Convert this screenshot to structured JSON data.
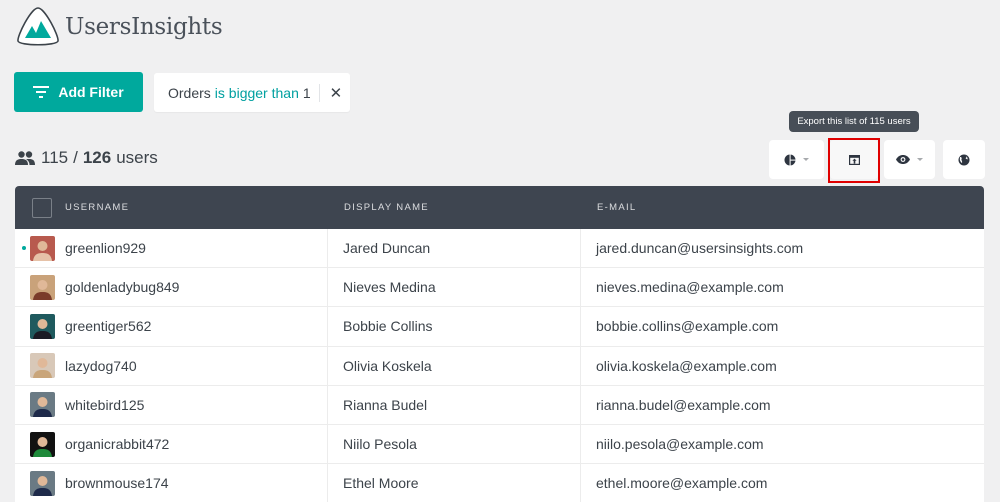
{
  "app": {
    "name": "UsersInsights",
    "accent_color": "#00a99d"
  },
  "toolbar": {
    "add_filter_label": "Add Filter",
    "filter": {
      "field": "Orders",
      "operator": "is bigger than",
      "value": "1",
      "remove_icon": "close-icon"
    }
  },
  "summary": {
    "filtered": "115",
    "separator": "/",
    "total": "126",
    "unit": "users",
    "icon": "users-icon"
  },
  "actions": {
    "tooltip": "Export this list of 115 users",
    "buttons": [
      {
        "name": "segments",
        "icon": "pie-chart-icon",
        "has_dropdown": true
      },
      {
        "name": "export",
        "icon": "export-icon",
        "has_dropdown": false
      },
      {
        "name": "columns",
        "icon": "eye-icon",
        "has_dropdown": true
      },
      {
        "name": "map",
        "icon": "globe-icon",
        "has_dropdown": false
      }
    ]
  },
  "table": {
    "columns": [
      "USERNAME",
      "DISPLAY NAME",
      "E-MAIL"
    ],
    "rows": [
      {
        "username": "greenlion929",
        "display_name": "Jared Duncan",
        "email": "jared.duncan@usersinsights.com",
        "online": true,
        "avatar_bg": "#b85a4e",
        "avatar_fg": "#e6c2a8"
      },
      {
        "username": "goldenladybug849",
        "display_name": "Nieves Medina",
        "email": "nieves.medina@example.com",
        "online": false,
        "avatar_bg": "#c9a27a",
        "avatar_fg": "#7a3b2a"
      },
      {
        "username": "greentiger562",
        "display_name": "Bobbie Collins",
        "email": "bobbie.collins@example.com",
        "online": false,
        "avatar_bg": "#1f5a5e",
        "avatar_fg": "#1a1a24"
      },
      {
        "username": "lazydog740",
        "display_name": "Olivia Koskela",
        "email": "olivia.koskela@example.com",
        "online": false,
        "avatar_bg": "#d8c8b8",
        "avatar_fg": "#c9a57a"
      },
      {
        "username": "whitebird125",
        "display_name": "Rianna Budel",
        "email": "rianna.budel@example.com",
        "online": false,
        "avatar_bg": "#6a7a84",
        "avatar_fg": "#1e2a4a"
      },
      {
        "username": "organicrabbit472",
        "display_name": "Niilo Pesola",
        "email": "niilo.pesola@example.com",
        "online": false,
        "avatar_bg": "#111111",
        "avatar_fg": "#1e8a3a"
      },
      {
        "username": "brownmouse174",
        "display_name": "Ethel Moore",
        "email": "ethel.moore@example.com",
        "online": false,
        "avatar_bg": "#6a7a84",
        "avatar_fg": "#1e2a4a"
      }
    ]
  }
}
